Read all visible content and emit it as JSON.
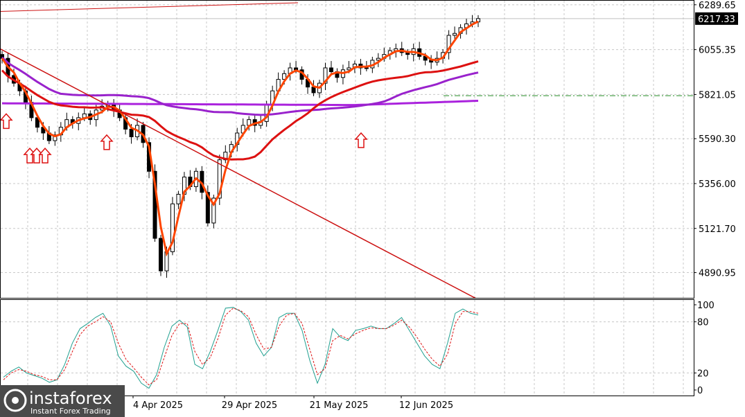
{
  "chart_data": [
    {
      "type": "candlestick",
      "title": "",
      "y_ticks": [
        "6289.65",
        "6055.35",
        "5821.05",
        "5590.30",
        "5356.00",
        "5121.70",
        "4890.95"
      ],
      "current_price": "6217.33",
      "ylim": [
        4770,
        6300
      ],
      "x_tick_labels": [
        "4 Apr 2025",
        "29 Apr 2025",
        "21 May 2025",
        "12 Jun 2025"
      ],
      "grid": true,
      "colors": {
        "candle": "#000000",
        "fast_ma": "#ff4500",
        "mid_ma": "#dd1111",
        "slow_ma": "#9922cc",
        "flat_ma": "#aa22dd",
        "trendline": "#cc1111",
        "arrow": "#dd1111",
        "level_line": "#228b22"
      },
      "closes": [
        6010,
        5920,
        5880,
        5840,
        5780,
        5700,
        5650,
        5620,
        5580,
        5610,
        5650,
        5690,
        5670,
        5700,
        5720,
        5690,
        5740,
        5760,
        5770,
        5740,
        5700,
        5640,
        5600,
        5660,
        5570,
        5420,
        5070,
        4900,
        5000,
        5250,
        5300,
        5390,
        5340,
        5420,
        5310,
        5150,
        5280,
        5480,
        5520,
        5560,
        5620,
        5660,
        5690,
        5660,
        5680,
        5770,
        5840,
        5900,
        5930,
        5960,
        5950,
        5900,
        5860,
        5830,
        5880,
        5960,
        5940,
        5910,
        5950,
        5960,
        5980,
        5960,
        5960,
        6000,
        6010,
        6030,
        6050,
        6060,
        6040,
        6030,
        6060,
        6020,
        6000,
        5990,
        6010,
        6040,
        6130,
        6140,
        6170,
        6190,
        6200,
        6217.33
      ],
      "signal_arrows": [
        "up",
        "up",
        "up",
        "up",
        "up",
        "up"
      ],
      "horizontal_level": 5815,
      "oscillator": {
        "ylim": [
          0,
          100
        ],
        "ticks": [
          "100",
          "80",
          "20",
          "0"
        ],
        "main": [
          15,
          22,
          27,
          20,
          17,
          14,
          9,
          12,
          30,
          55,
          72,
          78,
          85,
          90,
          75,
          40,
          28,
          22,
          8,
          2,
          18,
          50,
          75,
          82,
          74,
          30,
          25,
          45,
          70,
          96,
          97,
          92,
          82,
          55,
          40,
          50,
          85,
          90,
          90,
          70,
          35,
          8,
          30,
          72,
          62,
          58,
          70,
          72,
          75,
          72,
          72,
          78,
          85,
          70,
          55,
          40,
          30,
          25,
          55,
          90,
          95,
          90,
          88
        ],
        "signal": [
          12,
          20,
          24,
          22,
          18,
          16,
          12,
          12,
          24,
          45,
          65,
          75,
          80,
          86,
          80,
          55,
          36,
          26,
          15,
          6,
          12,
          38,
          64,
          78,
          78,
          45,
          30,
          38,
          60,
          88,
          96,
          93,
          86,
          65,
          48,
          50,
          75,
          88,
          90,
          78,
          48,
          18,
          25,
          58,
          64,
          60,
          66,
          70,
          73,
          72,
          72,
          76,
          82,
          74,
          62,
          48,
          36,
          28,
          42,
          78,
          92,
          92,
          90
        ]
      }
    }
  ],
  "logo": {
    "text": "instaforex",
    "tagline": "Instant Forex Trading"
  }
}
